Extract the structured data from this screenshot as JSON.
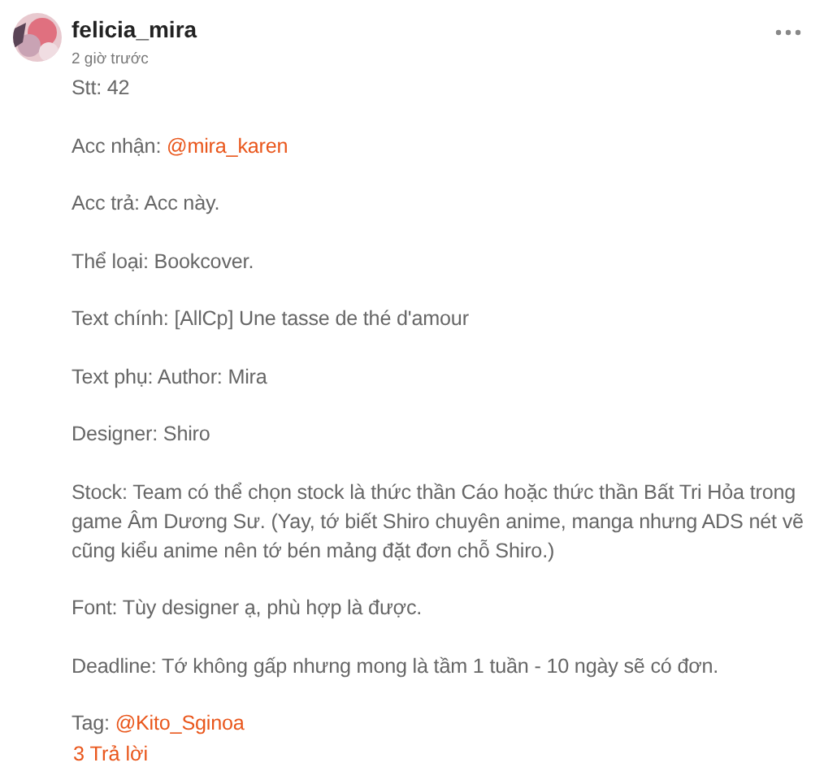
{
  "comment": {
    "author": "felicia_mira",
    "time": "2 giờ trước",
    "paragraphs": [
      {
        "text": "Stt: 42"
      },
      {
        "text": "Acc nhận: ",
        "mention": "@mira_karen"
      },
      {
        "text": "Acc trả: Acc này."
      },
      {
        "text": "Thể loại: Bookcover."
      },
      {
        "text": "Text chính: [AllCp] Une tasse de thé d'amour"
      },
      {
        "text": "Text phụ: Author: Mira"
      },
      {
        "text": "Designer: Shiro"
      },
      {
        "text": "Stock: Team có thể chọn stock là thức thần Cáo hoặc thức thần Bất Tri Hỏa trong game Âm Dương Sư. (Yay, tớ biết Shiro chuyên anime, manga nhưng ADS nét vẽ cũng kiểu anime nên tớ bén mảng đặt đơn chỗ Shiro.)"
      },
      {
        "text": "Font: Tùy designer ạ, phù hợp là được."
      },
      {
        "text": "Deadline: Tớ không gấp nhưng mong là tầm 1 tuần - 10 ngày sẽ có đơn."
      },
      {
        "text": "Tag: ",
        "mention": "@Kito_Sginoa"
      }
    ],
    "replies": "3 Trả lời"
  }
}
